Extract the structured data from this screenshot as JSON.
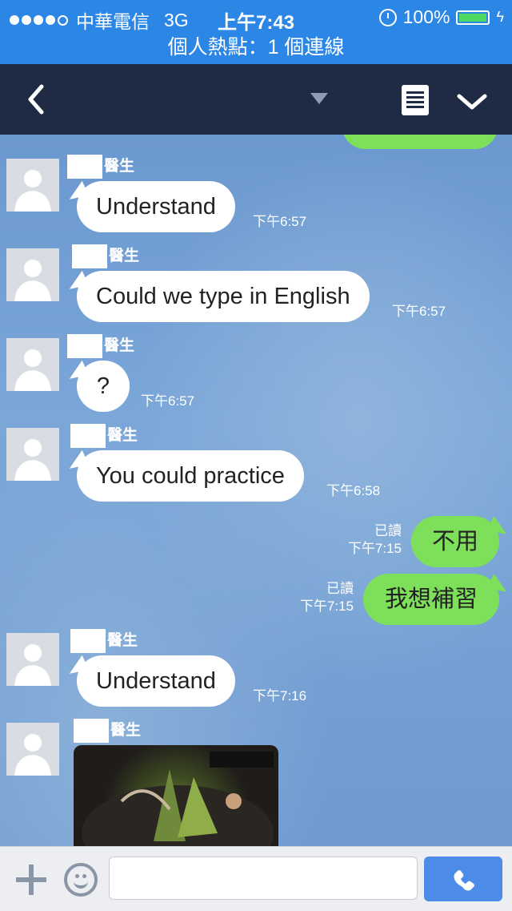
{
  "status_bar": {
    "carrier": "中華電信",
    "network": "3G",
    "time": "上午7:43",
    "battery": "100%"
  },
  "hotspot": {
    "text": "個人熱點：1 個連線"
  },
  "colors": {
    "status_bar": "#2b86e6",
    "nav": "#1f2a44",
    "outgoing_bubble": "#7ee05a",
    "send_button": "#4c8be8"
  },
  "icons": [
    "back-icon",
    "dropdown-icon",
    "note-icon",
    "chevron-down-icon",
    "alarm-icon",
    "battery-icon",
    "plus-icon",
    "emoji-icon",
    "phone-icon"
  ],
  "messages": [
    {
      "sender": "醫生",
      "text": "Understand",
      "time": "下午6:57"
    },
    {
      "sender": "醫生",
      "text": "Could we type in English",
      "time": "下午6:57"
    },
    {
      "sender": "醫生",
      "text": "?",
      "time": "下午6:57"
    },
    {
      "sender": "醫生",
      "text": "You could practice",
      "time": "下午6:58"
    },
    {
      "text": "不用",
      "read": "已讀",
      "time": "下午7:15"
    },
    {
      "text": "我想補習",
      "read": "已讀",
      "time": "下午7:15"
    },
    {
      "sender": "醫生",
      "text": "Understand",
      "time": "下午7:16"
    },
    {
      "sender": "醫生"
    }
  ],
  "input": {
    "placeholder": ""
  }
}
